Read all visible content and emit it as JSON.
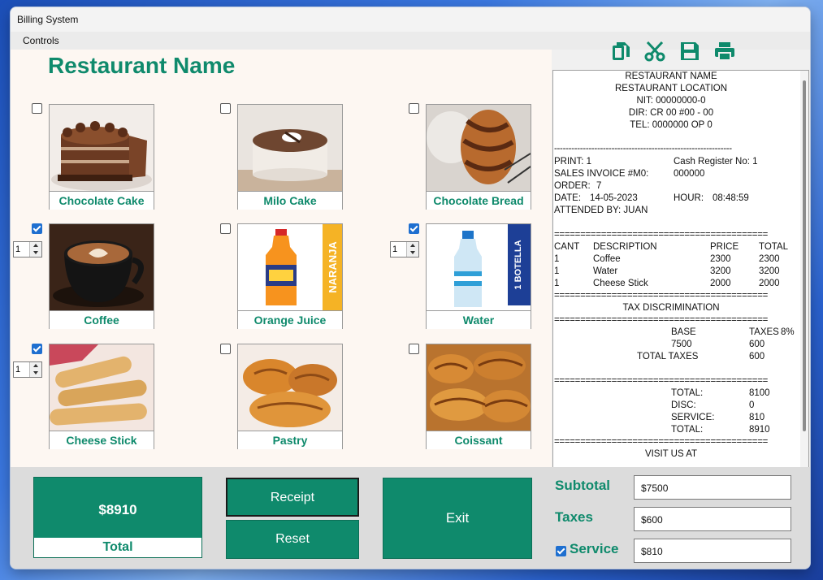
{
  "window": {
    "title": "Billing System"
  },
  "menu": {
    "controls": "Controls"
  },
  "restaurant": {
    "name": "Restaurant Name"
  },
  "products": [
    {
      "name": "Chocolate Cake",
      "checked": false,
      "qty": null
    },
    {
      "name": "Milo Cake",
      "checked": false,
      "qty": null
    },
    {
      "name": "Chocolate Bread",
      "checked": false,
      "qty": null
    },
    {
      "name": "Coffee",
      "checked": true,
      "qty": "1"
    },
    {
      "name": "Orange Juice",
      "checked": false,
      "qty": null
    },
    {
      "name": "Water",
      "checked": true,
      "qty": "1"
    },
    {
      "name": "Cheese Stick",
      "checked": true,
      "qty": "1"
    },
    {
      "name": "Pastry",
      "checked": false,
      "qty": null
    },
    {
      "name": "Coissant",
      "checked": false,
      "qty": null
    }
  ],
  "product_image_text": {
    "juice_band": "NARANJA",
    "water_band": "1 BOTELLA"
  },
  "toolbar": {
    "icons": [
      "copy-icon",
      "cut-icon",
      "save-icon",
      "print-icon"
    ]
  },
  "receipt": {
    "header": [
      "RESTAURANT NAME",
      "RESTAURANT LOCATION",
      "NIT: 00000000-0",
      "DIR: CR 00 #00 - 00",
      "TEL: 0000000 OP 0"
    ],
    "dash_line": "--------------------------------------------------------------",
    "eq_line": "=========================================",
    "print": "PRINT: 1",
    "cash_register": "Cash Register No: 1",
    "sales_invoice_label": "SALES INVOICE #M0:",
    "sales_invoice_value": "000000",
    "order_label": "ORDER:",
    "order_value": "7",
    "date_label": "DATE:",
    "date_value": "14-05-2023",
    "hour_label": "HOUR:",
    "hour_value": "08:48:59",
    "attended": "ATTENDED BY: JUAN",
    "columns": {
      "cant": "CANT",
      "description": "DESCRIPTION",
      "price": "PRICE",
      "total": "TOTAL"
    },
    "items": [
      {
        "cant": "1",
        "description": "Coffee",
        "price": "2300",
        "total": "2300"
      },
      {
        "cant": "1",
        "description": "Water",
        "price": "3200",
        "total": "3200"
      },
      {
        "cant": "1",
        "description": "Cheese Stick",
        "price": "2000",
        "total": "2000"
      }
    ],
    "tax_title": "TAX DISCRIMINATION",
    "base_label": "BASE",
    "taxes_label": "TAXES",
    "taxes_rate": "8%",
    "base_value": "7500",
    "taxes_value": "600",
    "total_taxes_label": "TOTAL TAXES",
    "total_taxes_value": "600",
    "total_label": "TOTAL:",
    "total_value": "8100",
    "disc_label": "DISC:",
    "disc_value": "0",
    "service_label": "SERVICE:",
    "service_value": "810",
    "grand_total_label": "TOTAL:",
    "grand_total_value": "8910",
    "visit": "VISIT US AT"
  },
  "totals": {
    "amount": "$8910",
    "label": "Total",
    "subtotal_label": "Subtotal",
    "subtotal_value": "$7500",
    "taxes_label": "Taxes",
    "taxes_value": "$600",
    "service_label": "Service",
    "service_value": "$810",
    "service_checked": true
  },
  "buttons": {
    "receipt": "Receipt",
    "reset": "Reset",
    "exit": "Exit"
  },
  "colors": {
    "accent": "#0f8a6c",
    "check": "#1e6fd0"
  }
}
